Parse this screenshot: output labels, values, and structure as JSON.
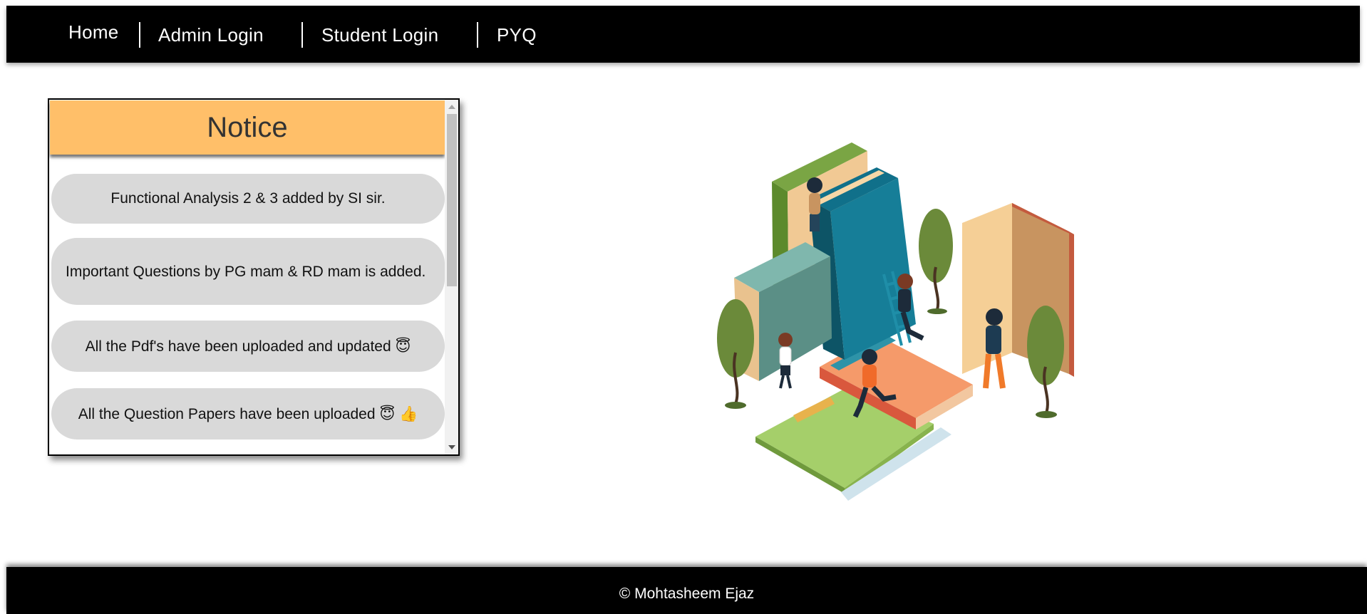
{
  "nav": {
    "home": "Home",
    "admin_login": "Admin Login",
    "student_login": "Student Login",
    "pyq": "PYQ"
  },
  "notice": {
    "title": "Notice",
    "items": [
      "Functional Analysis 2 & 3 added by SI sir.",
      "Important Questions by PG mam & RD mam is added.",
      "All the Pdf's have been uploaded and updated 😇",
      "All the Question Papers have been uploaded 😇 👍"
    ]
  },
  "footer": {
    "copyright": "© Mohtasheem Ejaz"
  },
  "colors": {
    "navbar": "#000000",
    "notice_header": "#ffbf69",
    "notice_item": "#d9d9d9",
    "footer": "#000000"
  },
  "icons": {
    "illustration": "books-students-illustration"
  }
}
